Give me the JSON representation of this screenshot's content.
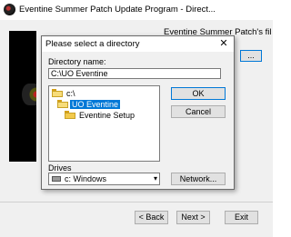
{
  "outer": {
    "title": "Eventine Summer Patch Update Program - Direct...",
    "info_text": "Eventine Summer Patch's files will be updated in the",
    "browse_label": "...",
    "back_label": "< Back",
    "next_label": "Next >",
    "exit_label": "Exit"
  },
  "dialog": {
    "title": "Please select a directory",
    "close_glyph": "✕",
    "dir_label": "Directory name:",
    "dir_value": "C:\\UO Eventine",
    "tree": [
      {
        "label": "c:\\",
        "icon": "open-folder-icon",
        "selected": false
      },
      {
        "label": "UO Eventine",
        "icon": "open-folder-icon",
        "selected": true
      },
      {
        "label": "Eventine Setup",
        "icon": "folder-icon",
        "selected": false
      }
    ],
    "ok_label": "OK",
    "cancel_label": "Cancel",
    "drives_label": "Drives",
    "drive_value": "c: Windows",
    "network_label": "Network...",
    "dropdown_glyph": "▾"
  }
}
